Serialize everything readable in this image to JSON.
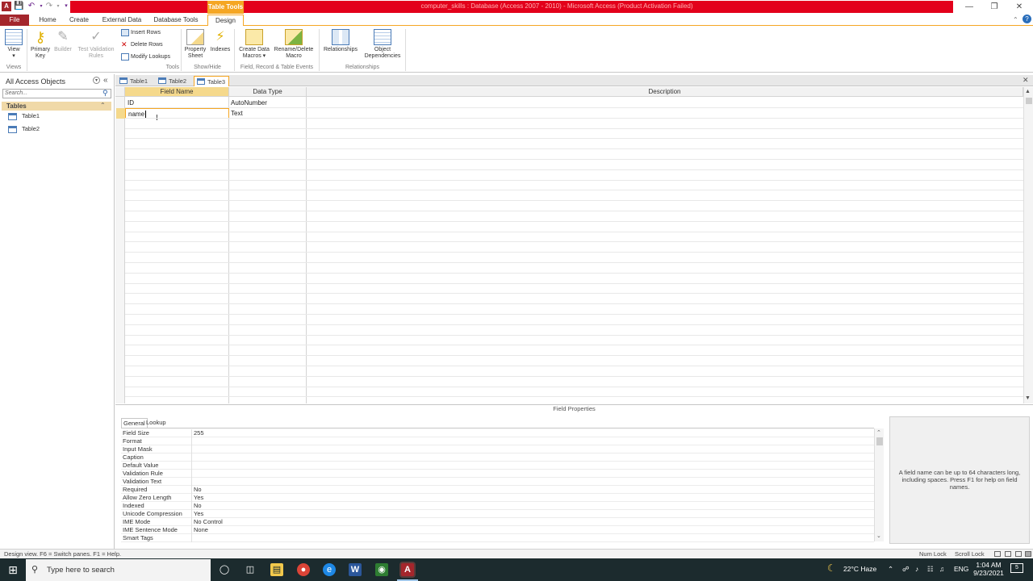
{
  "window": {
    "title": "computer_skills : Database (Access 2007 - 2010) - Microsoft Access (Product Activation Failed)",
    "context_tab": "Table Tools",
    "brand_color": "#a4262c",
    "context_color": "#f5a623",
    "title_color": "#e3001b"
  },
  "ribbon_tabs": [
    "File",
    "Home",
    "Create",
    "External Data",
    "Database Tools",
    "Design"
  ],
  "ribbon": {
    "view": "View",
    "primary_key": [
      "Primary",
      "Key"
    ],
    "builder": "Builder",
    "test_validation": [
      "Test Validation",
      "Rules"
    ],
    "insert_rows": "Insert Rows",
    "delete_rows": "Delete Rows",
    "modify_lookups": "Modify Lookups",
    "property_sheet": [
      "Property",
      "Sheet"
    ],
    "indexes": "Indexes",
    "create_data_macros": [
      "Create Data",
      "Macros"
    ],
    "rename_delete_macro": [
      "Rename/Delete",
      "Macro"
    ],
    "relationships": "Relationships",
    "object_dependencies": [
      "Object",
      "Dependencies"
    ],
    "groups": {
      "views": "Views",
      "tools": "Tools",
      "show_hide": "Show/Hide",
      "field_events": "Field, Record & Table Events",
      "relationships": "Relationships"
    }
  },
  "nav": {
    "title": "All Access Objects",
    "search_placeholder": "Search...",
    "section": "Tables",
    "items": [
      "Table1",
      "Table2"
    ]
  },
  "doc_tabs": [
    "Table1",
    "Table2",
    "Table3"
  ],
  "design": {
    "headers": [
      "Field Name",
      "Data Type",
      "Description"
    ],
    "rows": [
      {
        "field": "ID",
        "type": "AutoNumber",
        "desc": ""
      },
      {
        "field": "name",
        "type": "Text",
        "desc": ""
      }
    ]
  },
  "field_properties": {
    "label": "Field Properties",
    "tabs": [
      "General",
      "Lookup"
    ],
    "rows": [
      {
        "label": "Field Size",
        "value": "255"
      },
      {
        "label": "Format",
        "value": ""
      },
      {
        "label": "Input Mask",
        "value": ""
      },
      {
        "label": "Caption",
        "value": ""
      },
      {
        "label": "Default Value",
        "value": ""
      },
      {
        "label": "Validation Rule",
        "value": ""
      },
      {
        "label": "Validation Text",
        "value": ""
      },
      {
        "label": "Required",
        "value": "No"
      },
      {
        "label": "Allow Zero Length",
        "value": "Yes"
      },
      {
        "label": "Indexed",
        "value": "No"
      },
      {
        "label": "Unicode Compression",
        "value": "Yes"
      },
      {
        "label": "IME Mode",
        "value": "No Control"
      },
      {
        "label": "IME Sentence Mode",
        "value": "None"
      },
      {
        "label": "Smart Tags",
        "value": ""
      }
    ],
    "help": "A field name can be up to 64 characters long, including spaces. Press F1 for help on field names."
  },
  "status": {
    "left": "Design view.  F6 = Switch panes.  F1 = Help.",
    "num_lock": "Num Lock",
    "scroll_lock": "Scroll Lock"
  },
  "taskbar": {
    "search_placeholder": "Type here to search",
    "weather": "22°C  Haze",
    "language": "ENG",
    "time": "1:04 AM",
    "date": "9/23/2021",
    "notifications": "5"
  }
}
